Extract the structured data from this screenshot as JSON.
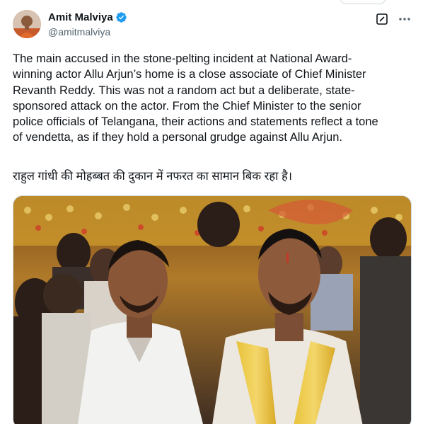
{
  "author": {
    "display_name": "Amit Malviya",
    "handle": "@amitmalviya",
    "verified": true,
    "verified_color": "#1d9bf0"
  },
  "icons": {
    "avatar": "avatar",
    "verified": "verified-badge-icon",
    "grok": "grok-icon",
    "more": "more-icon"
  },
  "tweet": {
    "text": "The main accused in the stone-pelting incident at National Award-\nwinning actor Allu Arjun’s home is a close associate of Chief Minister\nRevanth Reddy. This was not a random act but a deliberate, state-\nsponsored attack on the actor. From the Chief Minister to the senior\npolice officials of Telangana, their actions and statements reflect a tone\nof vendetta, as if they hold a personal grudge against Allu Arjun.",
    "text_hindi": "राहुल गांधी की मोहब्बत की दुकान में नफरत का सामान बिक रहा है।"
  },
  "media": {
    "type": "photo",
    "subject": "two men posing at a decorated event"
  }
}
